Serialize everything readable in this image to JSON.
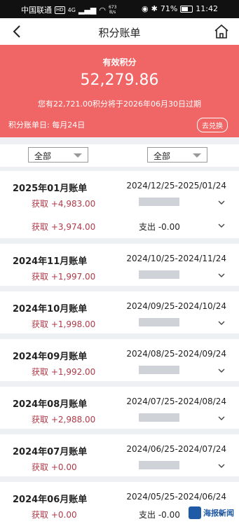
{
  "status_bar": {
    "carrier": "中国联通",
    "hd": "HD",
    "signal": "4G",
    "netspeed_value": "673",
    "netspeed_unit": "B/s",
    "battery_percent": "71%",
    "time": "11:42"
  },
  "header": {
    "title": "积分账单"
  },
  "summary": {
    "label": "有效积分",
    "amount": "52,279.86",
    "expire_note": "您有22,721.00积分将于2026年06月30日过期",
    "bill_day": "积分账单日: 每月24日",
    "exchange_label": "去兑换"
  },
  "filters": {
    "left": "全部",
    "right": "全部"
  },
  "bills": [
    {
      "month": "2025年01月账单",
      "range": "2024/12/25-2025/01/24",
      "earn": "获取 +4,983.00"
    },
    {
      "month": "2024年11月账单",
      "range": "2024/10/25-2024/11/24",
      "earn": "获取 +1,997.00"
    },
    {
      "month": "2024年10月账单",
      "range": "2024/09/25-2024/10/24",
      "earn": "获取 +1,998.00"
    },
    {
      "month": "2024年09月账单",
      "range": "2024/08/25-2024/09/24",
      "earn": "获取 +1,992.00"
    },
    {
      "month": "2024年08月账单",
      "range": "2024/07/25-2024/08/24",
      "earn": "获取 +2,988.00"
    },
    {
      "month": "2024年07月账单",
      "range": "2024/06/25-2024/07/24",
      "earn": "获取 +0.00"
    },
    {
      "month": "2024年06月账单",
      "range": "2024/05/25-2024/06/24",
      "earn": "获取 +0.00",
      "spend": "支出 -0.00"
    }
  ],
  "extra_row": {
    "earn": "获取 +3,974.00",
    "spend": "支出 -0.00"
  },
  "watermark": "海报新闻"
}
